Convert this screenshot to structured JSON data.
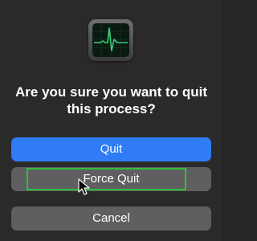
{
  "dialog": {
    "icon": "activity-monitor-icon",
    "message": "Are you sure you want to quit this process?",
    "buttons": {
      "quit": "Quit",
      "force_quit": "Force Quit",
      "cancel": "Cancel"
    }
  },
  "colors": {
    "background": "#2a2a2a",
    "primary_button": "#2f7cf6",
    "secondary_button": "#5f5f61",
    "highlight": "#2fc03e",
    "monitor_line": "#35d07a"
  }
}
